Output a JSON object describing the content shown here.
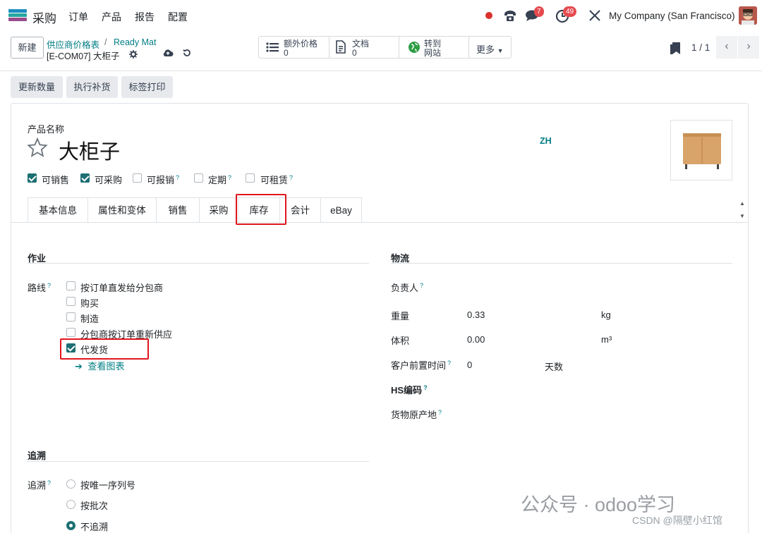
{
  "topnav": {
    "app_name": "采购",
    "menu": [
      "订单",
      "产品",
      "报告",
      "配置"
    ],
    "badges": {
      "messages": "7",
      "activities": "49"
    },
    "company": "My Company (San Francisco)"
  },
  "control": {
    "new_label": "新建",
    "breadcrumb": {
      "parent1": "供应商价格表",
      "sep": "/",
      "parent2": "Ready Mat",
      "current": "[E-COM07] 大柜子"
    },
    "stats": [
      {
        "label": "额外价格",
        "value": "0"
      },
      {
        "label": "文档",
        "value": "0"
      },
      {
        "label": "转到",
        "value": "网站"
      }
    ],
    "more_label": "更多",
    "pager": "1 / 1"
  },
  "actions": [
    "更新数量",
    "执行补货",
    "标签打印"
  ],
  "product": {
    "name_label": "产品名称",
    "name": "大柜子",
    "lang": "ZH",
    "flags": [
      {
        "label": "可销售",
        "checked": true,
        "help": false
      },
      {
        "label": "可采购",
        "checked": true,
        "help": false
      },
      {
        "label": "可报销",
        "checked": false,
        "help": true
      },
      {
        "label": "定期",
        "checked": false,
        "help": true
      },
      {
        "label": "可租赁",
        "checked": false,
        "help": true
      }
    ]
  },
  "tabs": [
    "基本信息",
    "属性和变体",
    "销售",
    "采购",
    "库存",
    "会计",
    "eBay"
  ],
  "active_tab": "库存",
  "operations": {
    "title": "作业",
    "routes_label": "路线",
    "routes": [
      {
        "label": "按订单直发给分包商",
        "checked": false
      },
      {
        "label": "购买",
        "checked": false
      },
      {
        "label": "制造",
        "checked": false
      },
      {
        "label": "分包商按订单重新供应",
        "checked": false
      },
      {
        "label": "代发货",
        "checked": true
      }
    ],
    "view_diagram": "查看图表"
  },
  "logistics": {
    "title": "物流",
    "responsible_label": "负责人",
    "weight_label": "重量",
    "weight_value": "0.33",
    "weight_unit": "kg",
    "volume_label": "体积",
    "volume_value": "0.00",
    "volume_unit": "m³",
    "lead_label": "客户前置时间",
    "lead_value": "0",
    "lead_unit": "天数",
    "hs_label": "HS编码",
    "origin_label": "货物原产地"
  },
  "traceability": {
    "title": "追溯",
    "label": "追溯",
    "options": [
      {
        "label": "按唯一序列号",
        "selected": false
      },
      {
        "label": "按批次",
        "selected": false
      },
      {
        "label": "不追溯",
        "selected": true
      }
    ]
  },
  "watermark": {
    "main": "公众号 · odoo学习",
    "sub": "CSDN @隔壁小红馆"
  },
  "colors": {
    "accent": "#017e84",
    "checkbox": "#1c6f72",
    "highlight": "#e0161e",
    "badge": "#e54a4f"
  }
}
